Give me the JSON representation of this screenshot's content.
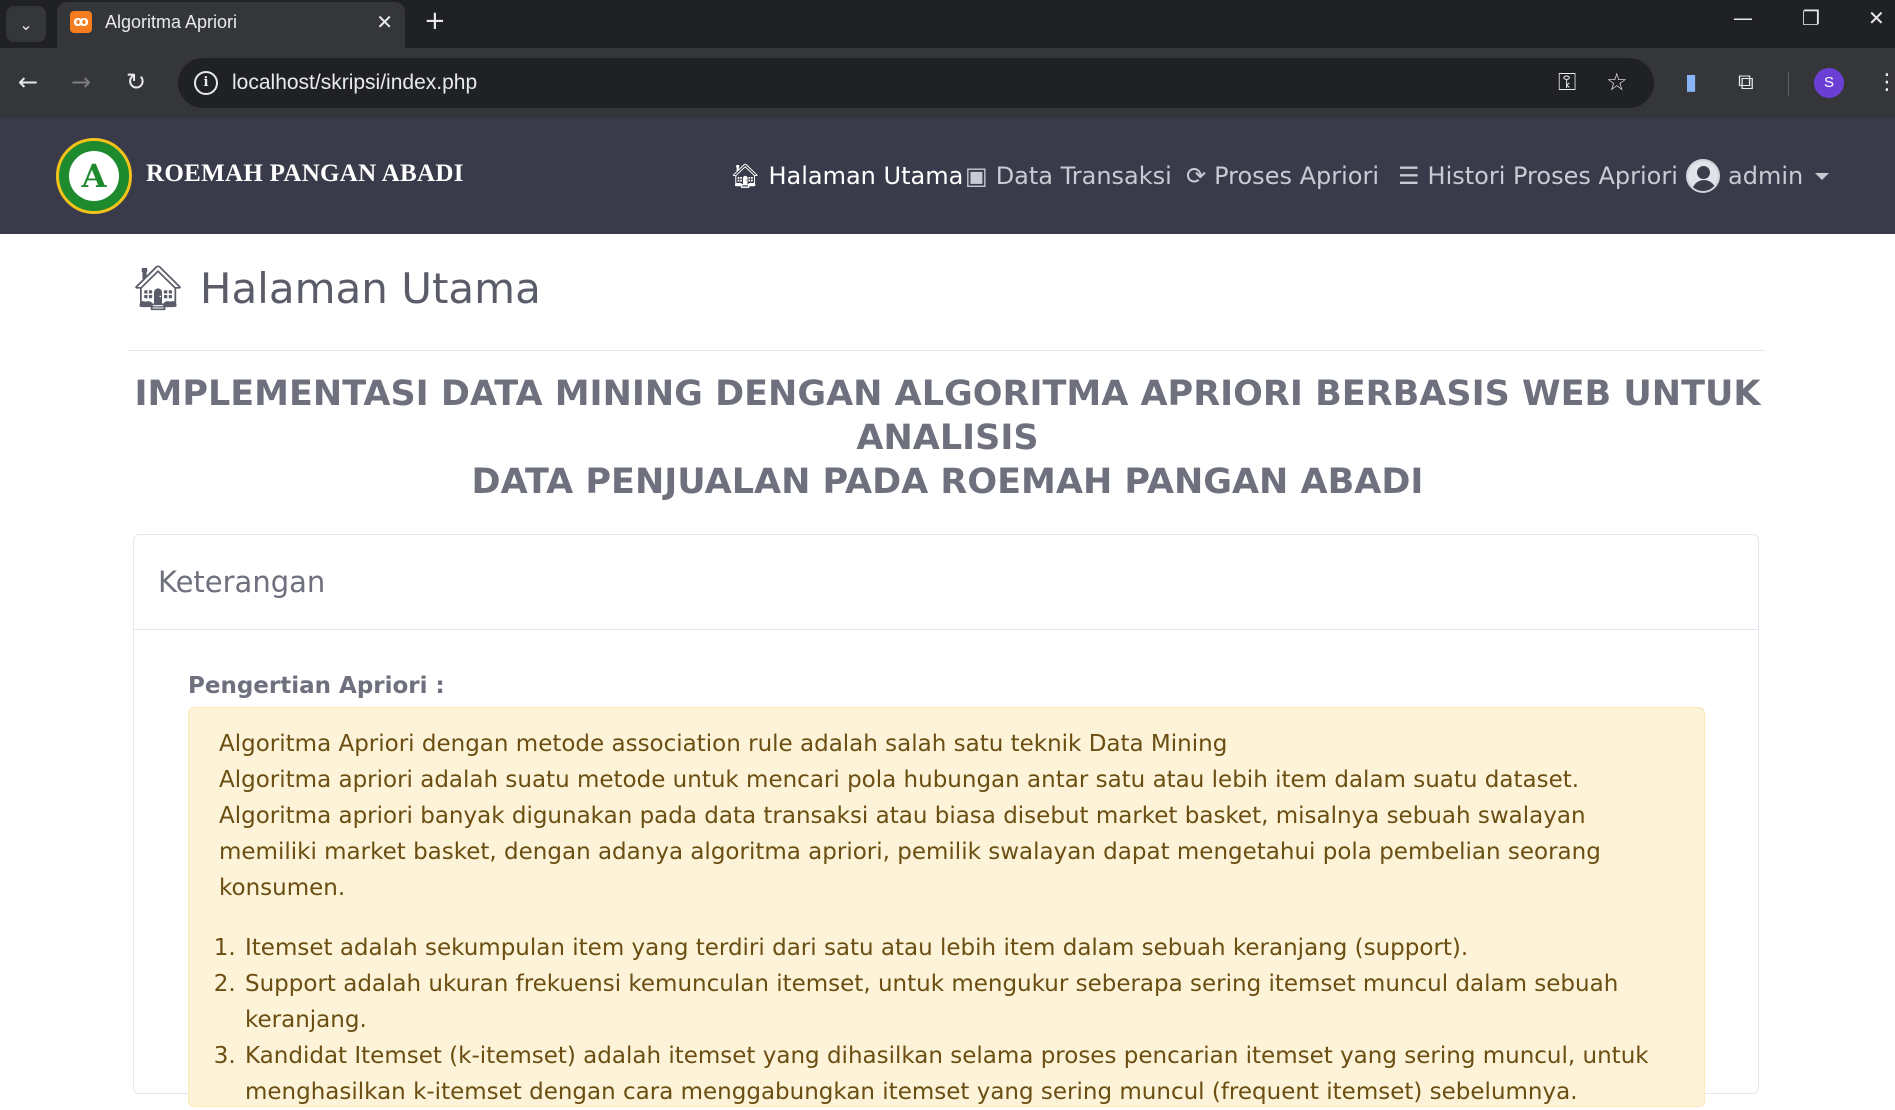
{
  "browser": {
    "tab_title": "Algoritma Apriori",
    "tab_favicon": "xampp-icon",
    "url": "localhost/skripsi/index.php",
    "profile_initial": "S"
  },
  "navbar": {
    "brand": "ROEMAH PANGAN ABADI",
    "menu": [
      {
        "label": "Halaman Utama",
        "icon": "home-icon",
        "active": true
      },
      {
        "label": "Data Transaksi",
        "icon": "money-icon",
        "active": false
      },
      {
        "label": "Proses Apriori",
        "icon": "refresh-icon",
        "active": false
      },
      {
        "label": "Histori Proses Apriori",
        "icon": "coins-icon",
        "active": false
      }
    ],
    "user": "admin"
  },
  "page": {
    "heading": "Halaman Utama",
    "title_line1": "IMPLEMENTASI DATA MINING DENGAN ALGORITMA APRIORI BERBASIS WEB UNTUK ANALISIS",
    "title_line2": "DATA PENJUALAN PADA ROEMAH PANGAN ABADI"
  },
  "card": {
    "header": "Keterangan",
    "section_label": "Pengertian Apriori :",
    "intro_line1": "Algoritma Apriori dengan metode association rule adalah salah satu teknik Data Mining",
    "intro_line2": "Algoritma apriori adalah suatu metode untuk mencari pola hubungan antar satu atau lebih item dalam suatu dataset. Algoritma apriori banyak digunakan pada data transaksi atau biasa disebut market basket, misalnya sebuah swalayan memiliki market basket, dengan adanya algoritma apriori, pemilik swalayan dapat mengetahui pola pembelian seorang konsumen.",
    "items": [
      "Itemset adalah sekumpulan item yang terdiri dari satu atau lebih item dalam sebuah keranjang (support).",
      "Support adalah ukuran frekuensi kemunculan itemset, untuk mengukur seberapa sering itemset muncul dalam sebuah keranjang.",
      "Kandidat Itemset (k-itemset) adalah itemset yang dihasilkan selama proses pencarian itemset yang sering muncul, untuk menghasilkan k-itemset dengan cara menggabungkan itemset yang sering muncul (frequent itemset) sebelumnya."
    ]
  },
  "colors": {
    "navbar_bg": "#3a3b4a",
    "alert_bg": "#fdf3d8",
    "alert_text": "#6a4e12"
  }
}
